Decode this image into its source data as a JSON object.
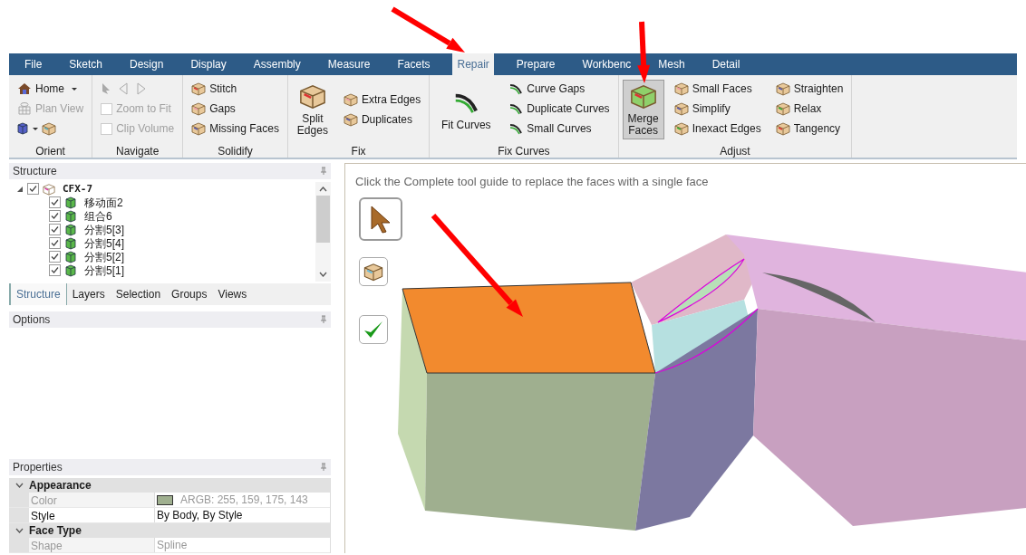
{
  "menu_tabs": [
    {
      "label": "File",
      "selected": false
    },
    {
      "label": "Sketch",
      "selected": false
    },
    {
      "label": "Design",
      "selected": false
    },
    {
      "label": "Display",
      "selected": false
    },
    {
      "label": "Assembly",
      "selected": false
    },
    {
      "label": "Measure",
      "selected": false
    },
    {
      "label": "Facets",
      "selected": false
    },
    {
      "label": "Repair",
      "selected": true
    },
    {
      "label": "Prepare",
      "selected": false
    },
    {
      "label": "Workbenc",
      "selected": false
    },
    {
      "label": "Mesh",
      "selected": false
    },
    {
      "label": "Detail",
      "selected": false
    }
  ],
  "ribbon": {
    "groups": [
      {
        "label": "Orient",
        "columns": [
          [
            {
              "label": "Home",
              "kind": "dropdown",
              "disabled": false,
              "selected": false
            },
            {
              "label": "Plan View",
              "kind": "small",
              "disabled": true,
              "selected": false
            }
          ]
        ]
      },
      {
        "label": "Navigate",
        "columns": [
          [
            {
              "label": "Zoom to Fit",
              "kind": "check",
              "disabled": true,
              "selected": false
            },
            {
              "label": "Clip Volume",
              "kind": "check",
              "disabled": true,
              "selected": false
            }
          ]
        ]
      },
      {
        "label": "Solidify",
        "columns": [
          [
            {
              "label": "Stitch",
              "kind": "small",
              "disabled": false,
              "selected": false
            },
            {
              "label": "Gaps",
              "kind": "small",
              "disabled": false,
              "selected": false
            },
            {
              "label": "Missing Faces",
              "kind": "small",
              "disabled": false,
              "selected": false
            }
          ]
        ]
      },
      {
        "label": "Fix",
        "columns": [
          [
            {
              "label": "Split Edges",
              "kind": "large",
              "disabled": false,
              "selected": false
            }
          ],
          [
            {
              "label": "Extra Edges",
              "kind": "small",
              "disabled": false,
              "selected": false
            },
            {
              "label": "Duplicates",
              "kind": "small",
              "disabled": false,
              "selected": false
            }
          ]
        ]
      },
      {
        "label": "Fix Curves",
        "columns": [
          [
            {
              "label": "Fit Curves",
              "kind": "large",
              "disabled": false,
              "selected": false
            }
          ],
          [
            {
              "label": "Curve Gaps",
              "kind": "small",
              "disabled": false,
              "selected": false
            },
            {
              "label": "Duplicate Curves",
              "kind": "small",
              "disabled": false,
              "selected": false
            },
            {
              "label": "Small Curves",
              "kind": "small",
              "disabled": false,
              "selected": false
            }
          ]
        ]
      },
      {
        "label": "Adjust",
        "columns": [
          [
            {
              "label": "Merge Faces",
              "kind": "large",
              "disabled": false,
              "selected": true
            }
          ],
          [
            {
              "label": "Small Faces",
              "kind": "small",
              "disabled": false,
              "selected": false
            },
            {
              "label": "Simplify",
              "kind": "small",
              "disabled": false,
              "selected": false
            },
            {
              "label": "Inexact Edges",
              "kind": "small",
              "disabled": false,
              "selected": false
            }
          ],
          [
            {
              "label": "Straighten",
              "kind": "small",
              "disabled": false,
              "selected": false
            },
            {
              "label": "Relax",
              "kind": "small",
              "disabled": false,
              "selected": false
            },
            {
              "label": "Tangency",
              "kind": "small",
              "disabled": false,
              "selected": false
            }
          ]
        ]
      }
    ]
  },
  "structure": {
    "title": "Structure",
    "tree": [
      {
        "label": "CFX-7",
        "checked": true,
        "expanded": true,
        "children": [
          {
            "label": "移动面2",
            "checked": true
          },
          {
            "label": "组合6",
            "checked": true
          },
          {
            "label": "分割5[3]",
            "checked": true
          },
          {
            "label": "分割5[4]",
            "checked": true
          },
          {
            "label": "分割5[2]",
            "checked": true
          },
          {
            "label": "分割5[1]",
            "checked": true
          }
        ]
      }
    ],
    "tabs": [
      {
        "label": "Structure",
        "selected": true
      },
      {
        "label": "Layers",
        "selected": false
      },
      {
        "label": "Selection",
        "selected": false
      },
      {
        "label": "Groups",
        "selected": false
      },
      {
        "label": "Views",
        "selected": false
      }
    ]
  },
  "options": {
    "title": "Options"
  },
  "properties": {
    "title": "Properties",
    "sections": [
      {
        "label": "Appearance",
        "expanded": true,
        "rows": [
          {
            "name": "Color",
            "value": "ARGB: 255, 159, 175, 143",
            "color": "#9faf8f",
            "disabled": true
          },
          {
            "name": "Style",
            "value": "By Body, By Style",
            "disabled": false
          }
        ]
      },
      {
        "label": "Face Type",
        "expanded": true,
        "rows": [
          {
            "name": "Shape",
            "value": "Spline",
            "disabled": true
          }
        ]
      }
    ]
  },
  "viewport": {
    "hint": "Click the Complete tool guide to replace the faces with a single face"
  }
}
